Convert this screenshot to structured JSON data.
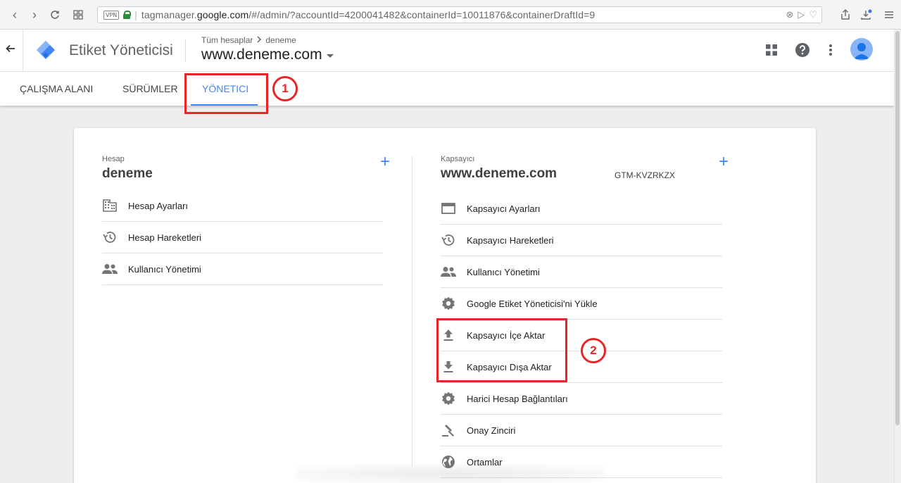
{
  "browser": {
    "vpn_label": "VPN",
    "url_prefix": "tagmanager.",
    "url_domain": "google.com",
    "url_rest": "/#/admin/?accountId=4200041482&containerId=10011876&containerDraftId=9"
  },
  "header": {
    "product_name": "Etiket Yöneticisi",
    "breadcrumb_root": "Tüm hesaplar",
    "breadcrumb_current": "deneme",
    "container_name": "www.deneme.com"
  },
  "tabs": [
    {
      "label": "ÇALIŞMA ALANI"
    },
    {
      "label": "SÜRÜMLER"
    },
    {
      "label": "YÖNETICI"
    }
  ],
  "account": {
    "label": "Hesap",
    "name": "deneme",
    "items": [
      {
        "label": "Hesap Ayarları",
        "icon": "building-icon"
      },
      {
        "label": "Hesap Hareketleri",
        "icon": "history-icon"
      },
      {
        "label": "Kullanıcı Yönetimi",
        "icon": "people-icon"
      }
    ]
  },
  "container": {
    "label": "Kapsayıcı",
    "name": "www.deneme.com",
    "id": "GTM-KVZRKZX",
    "items": [
      {
        "label": "Kapsayıcı Ayarları",
        "icon": "window-icon"
      },
      {
        "label": "Kapsayıcı Hareketleri",
        "icon": "history-icon"
      },
      {
        "label": "Kullanıcı Yönetimi",
        "icon": "people-icon"
      },
      {
        "label": "Google Etiket Yöneticisi'ni Yükle",
        "icon": "gear-icon"
      },
      {
        "label": "Kapsayıcı İçe Aktar",
        "icon": "upload-icon"
      },
      {
        "label": "Kapsayıcı Dışa Aktar",
        "icon": "download-icon"
      },
      {
        "label": "Harici Hesap Bağlantıları",
        "icon": "gear-icon"
      },
      {
        "label": "Onay Zinciri",
        "icon": "gavel-icon"
      },
      {
        "label": "Ortamlar",
        "icon": "globe-icon"
      }
    ]
  },
  "annotations": {
    "step1": "1",
    "step2": "2"
  },
  "colors": {
    "accent": "#4285f4",
    "annotation": "#e8262a"
  }
}
